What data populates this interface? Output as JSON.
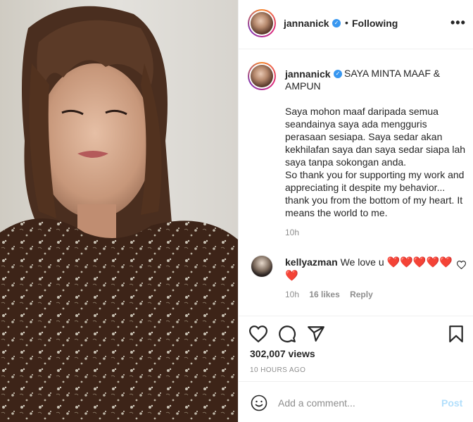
{
  "post": {
    "username": "jannanick",
    "follow_status": "Following",
    "more_label": "•••"
  },
  "caption": {
    "username": "jannanick",
    "title": "SAYA MINTA MAAF & AMPUN",
    "body": "Saya mohon maaf daripada semua seandainya saya ada mengguris perasaan sesiapa. Saya sedar akan kekhilafan saya dan saya sedar siapa lah saya tanpa sokongan anda.\nSo thank you for supporting my work and appreciating it despite my behavior... thank you from the bottom of my heart. It means the world to me.",
    "time": "10h"
  },
  "comment": {
    "username": "kellyazman",
    "text": "We love u",
    "emoji": "❤️❤️❤️❤️❤️❤️",
    "time": "10h",
    "likes": "16 likes",
    "reply_label": "Reply"
  },
  "stats": {
    "views": "302,007 views",
    "posted_ago": "10 HOURS AGO"
  },
  "add_comment": {
    "placeholder": "Add a comment...",
    "post_label": "Post"
  },
  "icons": {
    "verified": "verified-badge-icon",
    "like": "heart-icon",
    "comment": "comment-icon",
    "share": "paper-plane-icon",
    "save": "bookmark-icon",
    "emoji": "smiley-icon",
    "comment_like": "small-heart-icon"
  },
  "colors": {
    "verified_blue": "#3897f0",
    "post_button_disabled": "#b2dffc",
    "heart_red": "#e0141e"
  }
}
